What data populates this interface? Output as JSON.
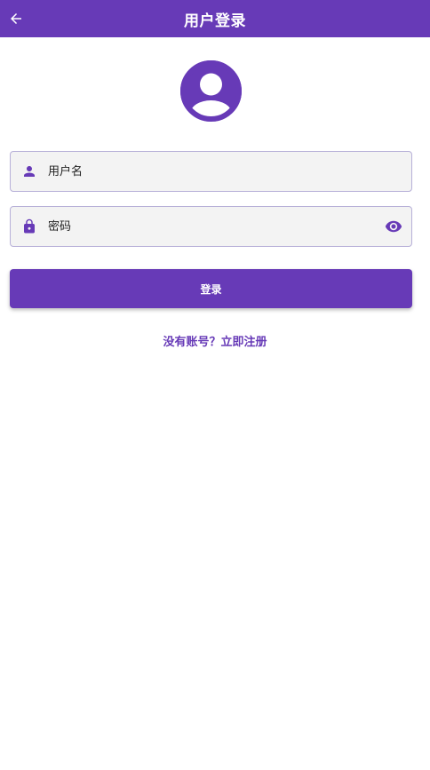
{
  "appbar": {
    "title": "用户登录",
    "back_icon": "arrow-left-icon"
  },
  "avatar": {
    "icon": "account-circle-icon"
  },
  "username_field": {
    "placeholder": "用户名",
    "value": "",
    "icon": "person-icon"
  },
  "password_field": {
    "placeholder": "密码",
    "value": "",
    "icon": "lock-icon",
    "toggle_icon": "eye-icon"
  },
  "login_button": {
    "label": "登录"
  },
  "register_link": {
    "label": "没有账号？立即注册"
  },
  "colors": {
    "primary": "#673ab7",
    "field_bg": "#f3f3f3",
    "field_border": "#b7b0d8"
  }
}
